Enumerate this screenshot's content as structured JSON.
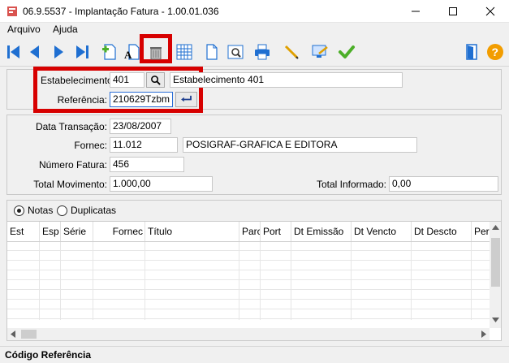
{
  "window": {
    "title": "06.9.5537 - Implantação Fatura - 1.00.01.036"
  },
  "menu": {
    "items": [
      "Arquivo",
      "Ajuda"
    ]
  },
  "header_form": {
    "estabelecimento_label": "Estabelecimento:",
    "estabelecimento_value": "401",
    "estabelecimento_desc": "Estabelecimento 401",
    "referencia_label": "Referência:",
    "referencia_value": "210629Tzbm"
  },
  "detail_form": {
    "data_transacao_label": "Data Transação:",
    "data_transacao_value": "23/08/2007",
    "fornec_label": "Fornec:",
    "fornec_value": "11.012",
    "fornec_name": "POSIGRAF-GRAFICA E EDITORA",
    "numero_fatura_label": "Número  Fatura:",
    "numero_fatura_value": "456",
    "total_movimento_label": "Total  Movimento:",
    "total_movimento_value": "1.000,00",
    "total_informado_label": "Total Informado:",
    "total_informado_value": "0,00"
  },
  "radio": {
    "notas_label": "Notas",
    "duplicatas_label": "Duplicatas",
    "selected": "Notas"
  },
  "grid": {
    "columns": [
      "Est",
      "Esp",
      "Série",
      "Fornec",
      "Título",
      "Parc",
      "Port",
      "Dt Emissão",
      "Dt Vencto",
      "Dt Descto",
      "Per"
    ]
  },
  "status": {
    "text": "Código Referência"
  },
  "colors": {
    "highlight": "#d70000",
    "focus_border": "#2b6ed6",
    "nav_blue": "#1f6fd1",
    "confirm_green": "#4caf28",
    "help_orange": "#f29d00"
  }
}
